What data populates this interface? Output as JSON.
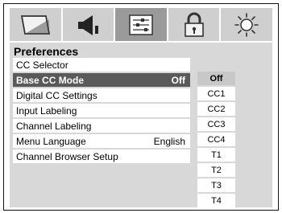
{
  "tabs": [
    {
      "icon": "picture-icon",
      "active": false
    },
    {
      "icon": "sound-icon",
      "active": false
    },
    {
      "icon": "setup-sliders-icon",
      "active": true
    },
    {
      "icon": "lock-icon",
      "active": false
    },
    {
      "icon": "sun-icon",
      "active": false
    }
  ],
  "panel": {
    "title": "Preferences"
  },
  "menu": {
    "items": [
      {
        "label": "CC Selector",
        "value": ""
      },
      {
        "label": "Base CC Mode",
        "value": "Off"
      },
      {
        "label": "Digital CC Settings",
        "value": ""
      },
      {
        "label": "Input Labeling",
        "value": ""
      },
      {
        "label": "Channel Labeling",
        "value": ""
      },
      {
        "label": "Menu Language",
        "value": "English"
      },
      {
        "label": "Channel Browser Setup",
        "value": ""
      }
    ]
  },
  "options": {
    "items": [
      "Off",
      "CC1",
      "CC2",
      "CC3",
      "CC4",
      "T1",
      "T2",
      "T3",
      "T4"
    ],
    "selected": "Off"
  },
  "colors": {
    "selected_row": "#5a5a5a",
    "panel_bg": "#d8d8d8",
    "tab_bg": "#cfcfcf",
    "active_tab_bg": "#9a9a9a"
  }
}
